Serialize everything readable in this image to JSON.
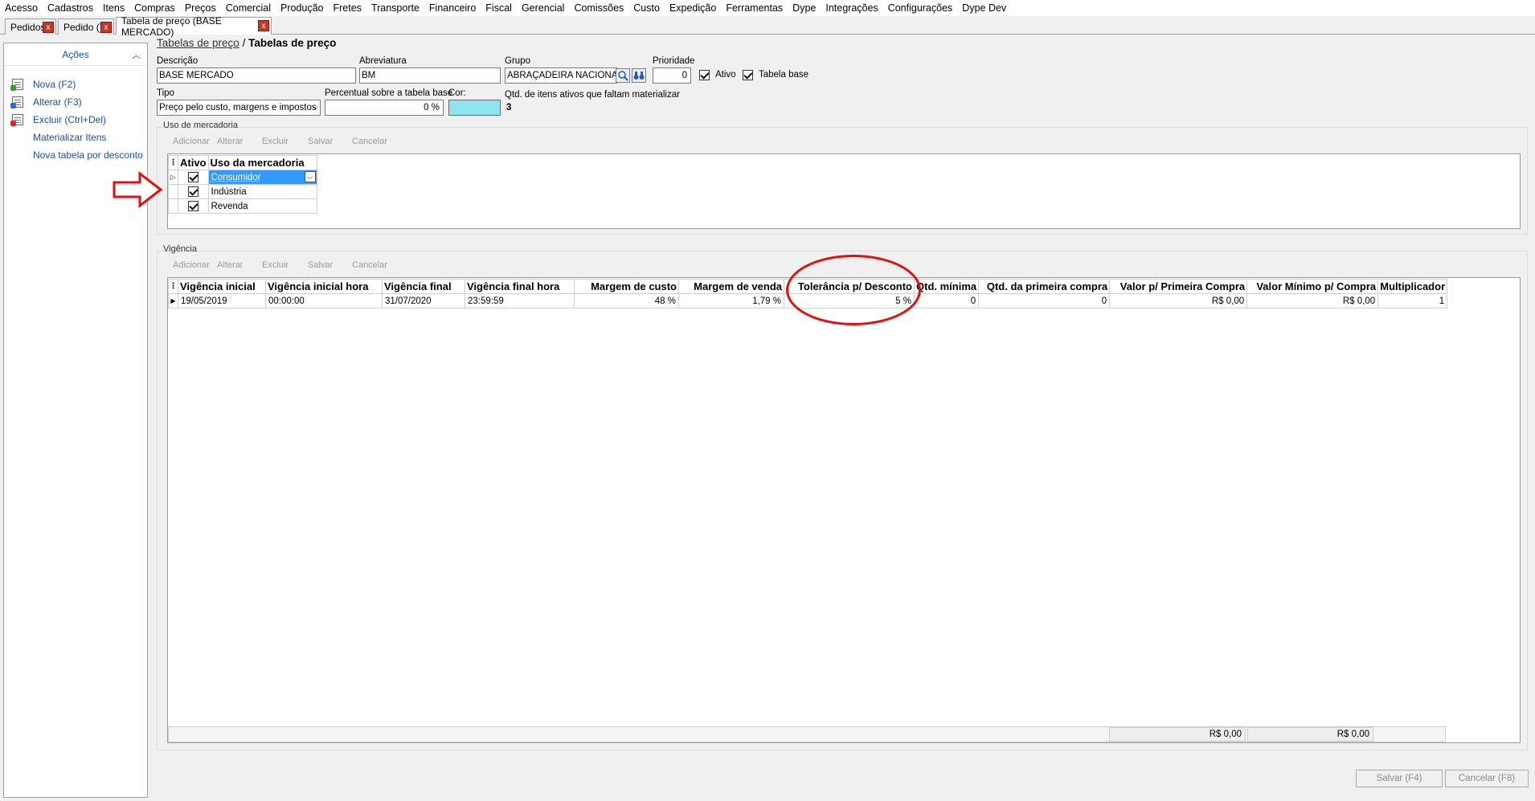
{
  "menu": [
    "Acesso",
    "Cadastros",
    "Itens",
    "Compras",
    "Preços",
    "Comercial",
    "Produção",
    "Fretes",
    "Transporte",
    "Financeiro",
    "Fiscal",
    "Gerencial",
    "Comissões",
    "Custo",
    "Expedição",
    "Ferramentas",
    "Dype",
    "Integrações",
    "Configurações",
    "Dype Dev"
  ],
  "tabs": [
    {
      "label": "Pedidos",
      "active": false
    },
    {
      "label": "Pedido ()",
      "active": false
    },
    {
      "label": "Tabela de preço (BASE MERCADO)",
      "active": true
    }
  ],
  "tab_close_glyph": "x",
  "sidebar": {
    "title": "Ações",
    "items": [
      "Nova (F2)",
      "Alterar (F3)",
      "Excluir (Ctrl+Del)",
      "Materializar Itens",
      "Nova tabela por desconto"
    ]
  },
  "breadcrumb": {
    "link": "Tabelas de preço",
    "sep": "/",
    "current": "Tabelas de preço"
  },
  "form": {
    "descricao_label": "Descrição",
    "descricao_value": "BASE MERCADO",
    "abreviatura_label": "Abreviatura",
    "abreviatura_value": "BM",
    "grupo_label": "Grupo",
    "grupo_value": "ABRAÇADEIRA NACIONAL (",
    "prioridade_label": "Prioridade",
    "prioridade_value": "0",
    "ativo_label": "Ativo",
    "tabela_base_label": "Tabela base",
    "tipo_label": "Tipo",
    "tipo_value": "Preço pelo custo, margens e impostos",
    "percentual_label": "Percentual sobre a tabela base",
    "percentual_value": "0 %",
    "cor_label": "Cor:",
    "cor_value": "#8ee5ef",
    "qtd_label": "Qtd. de itens ativos que faltam materializar",
    "qtd_value": "3"
  },
  "toolbar": [
    "Adicionar",
    "Alterar",
    "Excluir",
    "Salvar",
    "Cancelar"
  ],
  "uso": {
    "title": "Uso de mercadoria",
    "columns": [
      "Ativo",
      "Uso da mercadoria"
    ],
    "rows": [
      {
        "ativo": true,
        "uso": "Consumidor"
      },
      {
        "ativo": true,
        "uso": "Indústria"
      },
      {
        "ativo": true,
        "uso": "Revenda"
      }
    ]
  },
  "vigencia": {
    "title": "Vigência",
    "columns": [
      "Vigência inicial",
      "Vigência inicial hora",
      "Vigência final",
      "Vigência final hora",
      "Margem de custo",
      "Margem de venda",
      "Tolerância p/ Desconto",
      "Qtd. mínima",
      "Qtd. da primeira compra",
      "Valor p/ Primeira Compra",
      "Valor Mínimo p/ Compra",
      "Multiplicador"
    ],
    "rows": [
      [
        "19/05/2019",
        "00:00:00",
        "31/07/2020",
        "23:59:59",
        "48 %",
        "1,79 %",
        "5 %",
        "0",
        "0",
        "R$ 0,00",
        "R$ 0,00",
        "1"
      ]
    ],
    "footer": {
      "valor_primeira_compra": "R$ 0,00",
      "valor_minimo": "R$ 0,00"
    }
  },
  "buttons": {
    "salvar": "Salvar (F4)",
    "cancelar": "Cancelar (F8)"
  },
  "annotation_color": "#e01010"
}
